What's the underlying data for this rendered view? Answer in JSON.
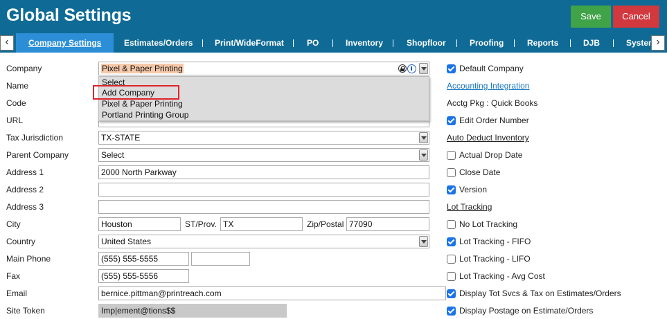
{
  "header": {
    "title": "Global Settings",
    "save_label": "Save",
    "cancel_label": "Cancel"
  },
  "tabs": [
    "Company Settings",
    "Estimates/Orders",
    "Print/WideFormat",
    "PO",
    "Inventory",
    "Shopfloor",
    "Proofing",
    "Reports",
    "DJB",
    "System"
  ],
  "active_tab": "Company Settings",
  "form": {
    "company": {
      "label": "Company",
      "value": "Pixel & Paper Printing"
    },
    "name": {
      "label": "Name"
    },
    "code": {
      "label": "Code"
    },
    "url": {
      "label": "URL"
    },
    "tax_jurisdiction": {
      "label": "Tax Jurisdiction",
      "value": "TX-STATE"
    },
    "parent_company": {
      "label": "Parent Company",
      "value": "Select"
    },
    "address1": {
      "label": "Address 1",
      "value": "2000 North Parkway"
    },
    "address2": {
      "label": "Address 2",
      "value": ""
    },
    "address3": {
      "label": "Address 3",
      "value": ""
    },
    "city": {
      "label": "City",
      "value": "Houston"
    },
    "state": {
      "label": "ST/Prov.",
      "value": "TX"
    },
    "zip": {
      "label": "Zip/Postal",
      "value": "77090"
    },
    "country": {
      "label": "Country",
      "value": "United States"
    },
    "main_phone": {
      "label": "Main Phone",
      "value": "(555) 555-5555",
      "ext": ""
    },
    "fax": {
      "label": "Fax",
      "value": "(555) 555-5556"
    },
    "email": {
      "label": "Email",
      "value": "bernice.pittman@printreach.com"
    },
    "site_token": {
      "label": "Site Token",
      "value": "Imp|ement@tions$$"
    }
  },
  "company_dropdown": {
    "options": [
      "Select",
      "Add Company",
      "Pixel & Paper Printing",
      "Portland Printing Group"
    ],
    "highlighted": "Add Company"
  },
  "right_panel": {
    "default_company": {
      "label": "Default Company",
      "checked": true
    },
    "accounting_integration": "Accounting Integration",
    "acctg_pkg": "Acctg Pkg : Quick Books",
    "edit_order_number": {
      "label": "Edit Order Number",
      "checked": true
    },
    "auto_deduct_inventory": "Auto Deduct Inventory",
    "actual_drop_date": {
      "label": "Actual Drop Date",
      "checked": false
    },
    "close_date": {
      "label": "Close Date",
      "checked": false
    },
    "version": {
      "label": "Version",
      "checked": true
    },
    "lot_tracking_heading": "Lot Tracking",
    "no_lot_tracking": {
      "label": "No Lot Tracking",
      "checked": false
    },
    "lot_fifo": {
      "label": "Lot Tracking - FIFO",
      "checked": true
    },
    "lot_lifo": {
      "label": "Lot Tracking - LIFO",
      "checked": false
    },
    "lot_avg": {
      "label": "Lot Tracking - Avg Cost",
      "checked": false
    },
    "display_tot_svcs": {
      "label": "Display Tot Svcs & Tax on Estimates/Orders",
      "checked": true
    },
    "display_postage": {
      "label": "Display Postage on Estimate/Orders",
      "checked": true
    }
  },
  "colors": {
    "header_bg": "#0f6b96",
    "active_tab_bg": "#2b8ed6",
    "save_bg": "#40a347",
    "cancel_bg": "#d1393f",
    "checkbox_on": "#1a73e8",
    "highlight_border": "#e0222a"
  },
  "icons": {
    "scroll_left": "chevron-left-icon",
    "scroll_right": "chevron-right-icon",
    "lock": "lock-icon",
    "info": "info-icon"
  }
}
